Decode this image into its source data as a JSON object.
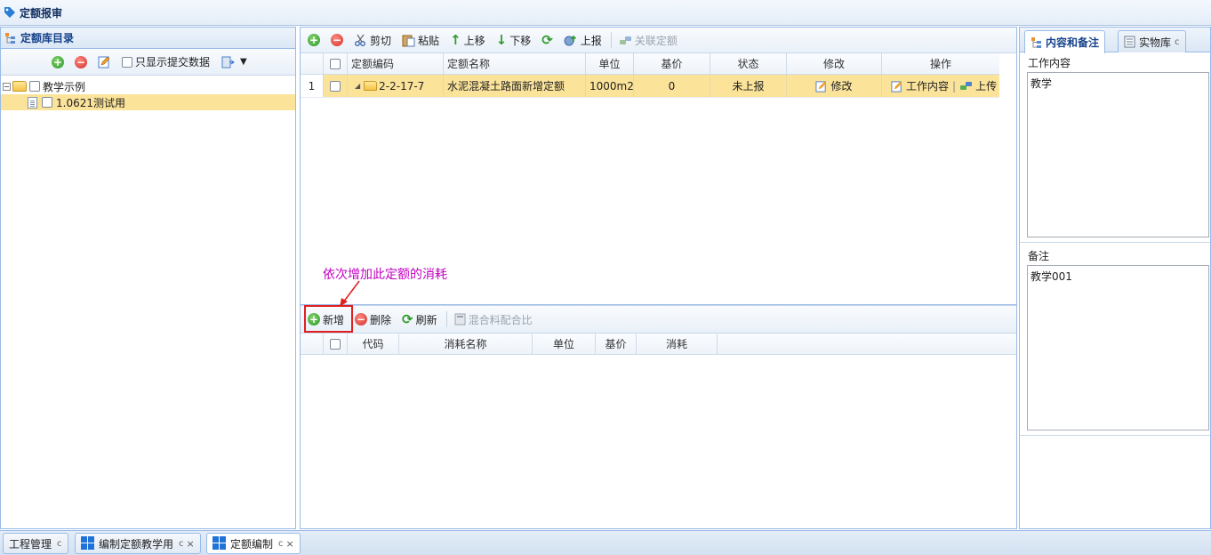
{
  "window": {
    "title": "定额报审"
  },
  "left": {
    "header": "定额库目录",
    "toolbar": {
      "show_submitted_label": "只显示提交数据"
    },
    "tree": [
      {
        "label": "教学示例"
      },
      {
        "label": "1.0621测试用"
      }
    ]
  },
  "upper": {
    "toolbar": {
      "cut": "剪切",
      "paste": "粘贴",
      "move_up": "上移",
      "move_down": "下移",
      "report": "上报",
      "link_quota": "关联定额"
    },
    "columns": [
      "定额编码",
      "定额名称",
      "单位",
      "基价",
      "状态",
      "修改",
      "操作"
    ],
    "rows": [
      {
        "index": "1",
        "code": "2-2-17-7",
        "name": "水泥混凝土路面新增定额",
        "unit": "1000m2",
        "price": "0",
        "status": "未上报",
        "edit": "修改",
        "op_content": "工作内容",
        "op_upload": "上传"
      }
    ]
  },
  "annotation": {
    "text": "依次增加此定额的消耗"
  },
  "lower": {
    "toolbar": {
      "add": "新增",
      "delete": "删除",
      "refresh": "刷新",
      "mix_ratio": "混合料配合比"
    },
    "columns": [
      "代码",
      "消耗名称",
      "单位",
      "基价",
      "消耗"
    ]
  },
  "right": {
    "tabs": [
      {
        "label": "内容和备注"
      },
      {
        "label": "实物库"
      }
    ],
    "work_content_label": "工作内容",
    "work_content_value": "教学",
    "note_label": "备注",
    "note_value": "教学001"
  },
  "bottom_tabs": [
    {
      "label": "工程管理"
    },
    {
      "label": "编制定额教学用"
    },
    {
      "label": "定额编制"
    }
  ]
}
